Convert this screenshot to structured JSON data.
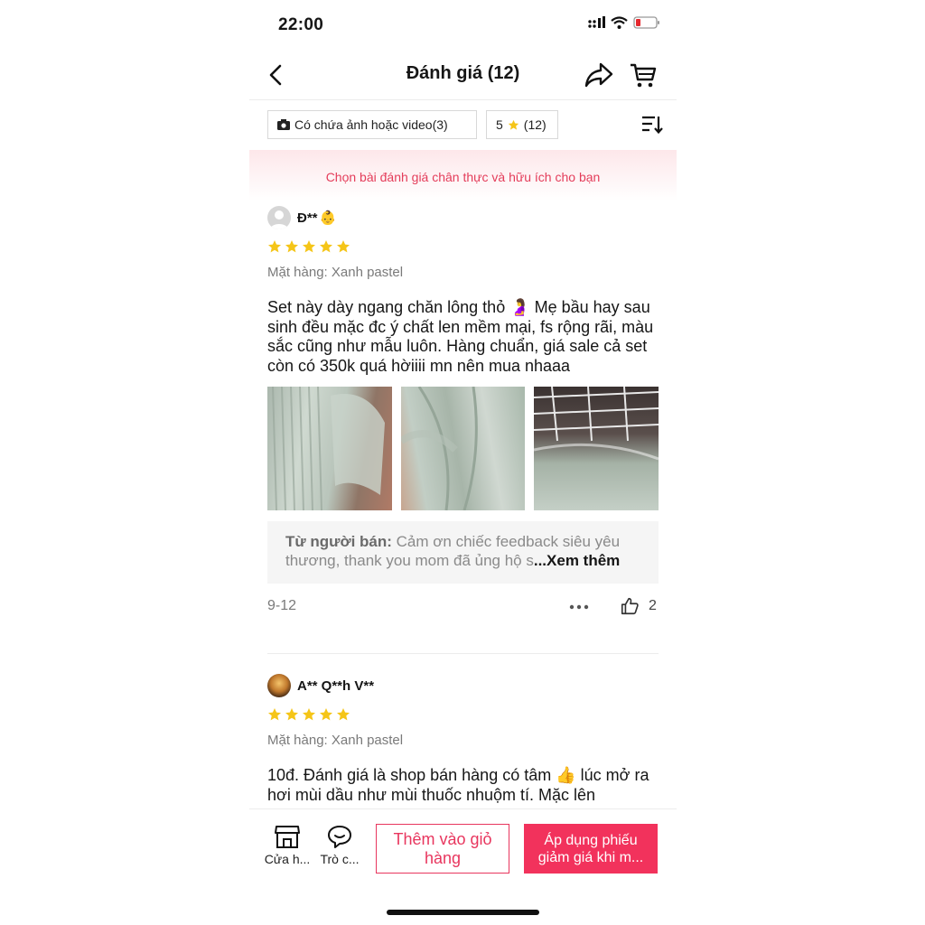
{
  "status": {
    "time": "22:00"
  },
  "header": {
    "title": "Đánh giá (12)"
  },
  "filters": {
    "media_label": "Có chứa ảnh hoặc video(3)",
    "rating_value": "5",
    "rating_count": "(12)"
  },
  "banner": {
    "text": "Chọn bài đánh giá chân thực và hữu ích cho bạn"
  },
  "reviews": [
    {
      "user": "Đ**",
      "user_emoji": "👶",
      "rating": 5,
      "variant": "Mặt hàng: Xanh pastel",
      "text": "Set này dày ngang chăn lông thỏ 🤰 Mẹ bầu hay sau sinh đều mặc đc ý chất len mềm mại, fs rộng rãi, màu sắc cũng như mẫu luôn. Hàng chuẩn, giá sale cả set còn có 350k quá hờiiii mn nên mua nhaaa",
      "seller_label": "Từ người bán:",
      "seller_reply": " Cảm ơn chiếc feedback siêu yêu thương, thank you mom đã ủng hộ s",
      "see_more": "...Xem thêm",
      "date": "9-12",
      "likes": "2"
    },
    {
      "user": "A** Q**h V**",
      "rating": 5,
      "variant": "Mặt hàng: Xanh pastel",
      "text": "10đ. Đánh giá là shop bán hàng có tâm 👍 lúc mở ra hơi mùi dầu như mùi thuốc nhuộm tí. Mặc lên"
    }
  ],
  "bottom": {
    "shop_label": "Cửa h...",
    "chat_label": "Trò c...",
    "add_to_cart": "Thêm vào giỏ hàng",
    "apply_voucher": "Áp dụng phiếu giảm giá khi m..."
  },
  "colors": {
    "accent": "#f2325c",
    "star": "#f5c518",
    "banner_text": "#e43d5a"
  }
}
